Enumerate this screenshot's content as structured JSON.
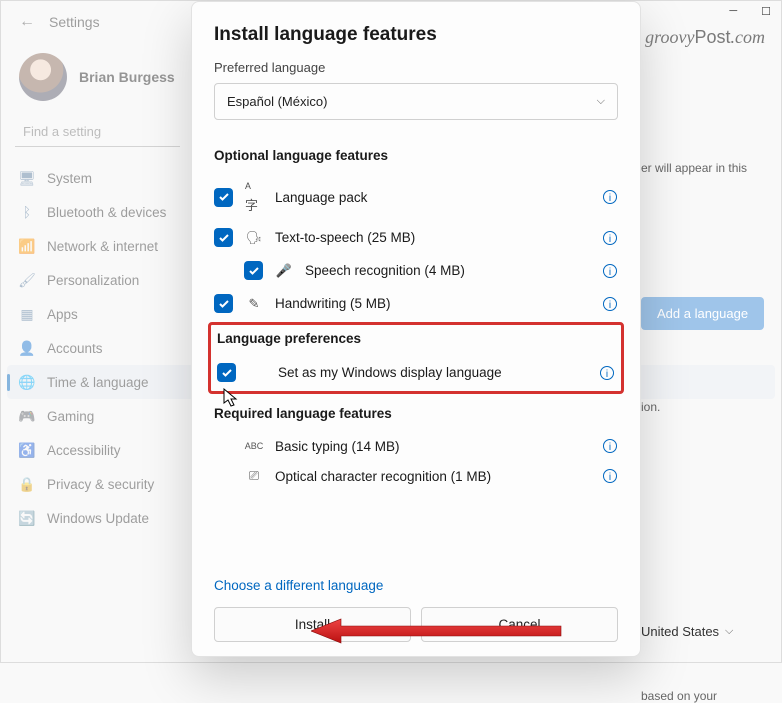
{
  "window": {
    "title": "Settings"
  },
  "user": {
    "name": "Brian Burgess"
  },
  "search": {
    "placeholder": "Find a setting"
  },
  "nav": [
    {
      "label": "System",
      "icon": "🖥"
    },
    {
      "label": "Bluetooth & devices",
      "icon": "ᛒ"
    },
    {
      "label": "Network & internet",
      "icon": "📶"
    },
    {
      "label": "Personalization",
      "icon": "🖌"
    },
    {
      "label": "Apps",
      "icon": "▦"
    },
    {
      "label": "Accounts",
      "icon": "👤"
    },
    {
      "label": "Time & language",
      "icon": "🌐",
      "selected": true
    },
    {
      "label": "Gaming",
      "icon": "🎮"
    },
    {
      "label": "Accessibility",
      "icon": "♿"
    },
    {
      "label": "Privacy & security",
      "icon": "🔒"
    },
    {
      "label": "Windows Update",
      "icon": "🔄"
    }
  ],
  "bg_right": {
    "text1": "er will appear in this",
    "add_button": "Add a language",
    "text2": "ion.",
    "country": "United States",
    "text3": "based on your"
  },
  "modal": {
    "title": "Install language features",
    "preferred_label": "Preferred language",
    "dropdown_value": "Español (México)",
    "sections": {
      "optional": "Optional language features",
      "prefs": "Language preferences",
      "required": "Required language features"
    },
    "features": {
      "lang_pack": "Language pack",
      "tts": "Text-to-speech (25 MB)",
      "speech": "Speech recognition (4 MB)",
      "handwriting": "Handwriting (5 MB)",
      "display": "Set as my Windows display language",
      "typing": "Basic typing (14 MB)",
      "ocr": "Optical character recognition (1 MB)"
    },
    "diff_link": "Choose a different language",
    "install": "Install",
    "cancel": "Cancel"
  },
  "watermark": "groovyPost.com"
}
